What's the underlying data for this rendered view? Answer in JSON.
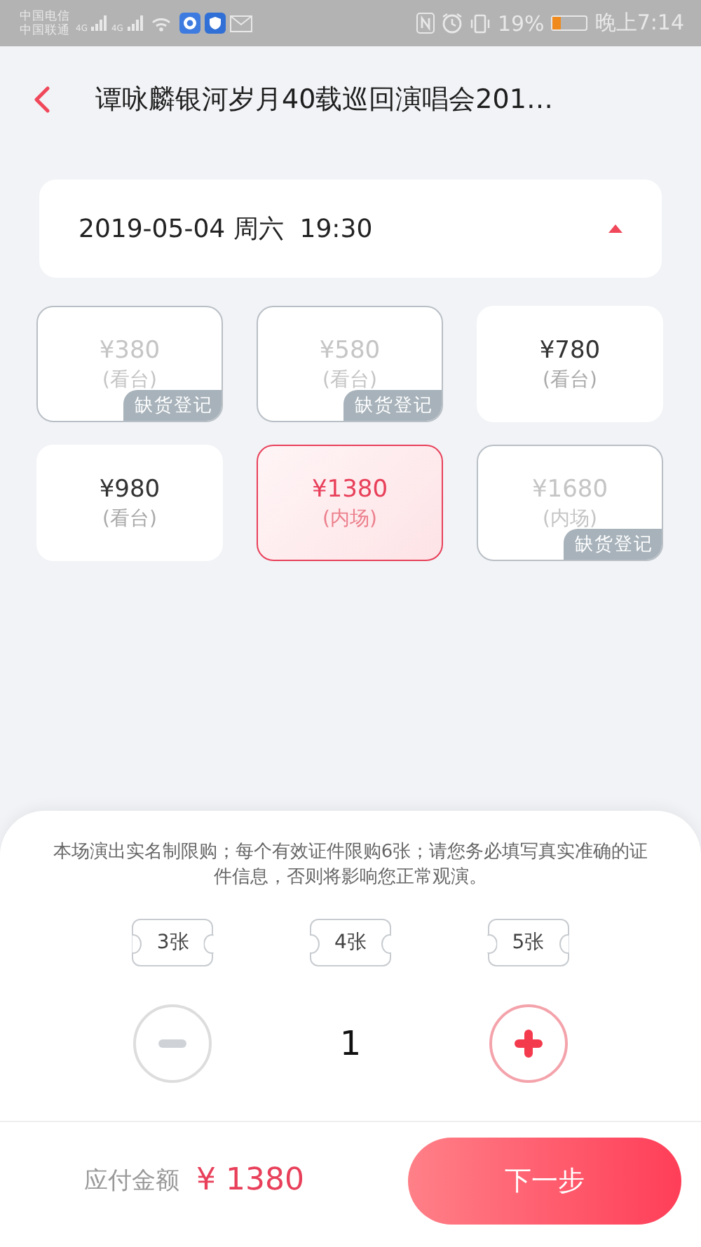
{
  "status_bar": {
    "carriers": [
      "中国电信",
      "中国联通"
    ],
    "networks": [
      "4G",
      "4G"
    ],
    "battery": "19%",
    "time": "晚上7:14"
  },
  "header": {
    "title": "谭咏麟银河岁月40载巡回演唱会201…"
  },
  "session": {
    "date": "2019-05-04 周六  19:30",
    "expanded": true
  },
  "tickets": [
    {
      "price": "¥380",
      "area": "(看台)",
      "available": false,
      "selected": false,
      "tag": "缺货登记"
    },
    {
      "price": "¥580",
      "area": "(看台)",
      "available": false,
      "selected": false,
      "tag": "缺货登记"
    },
    {
      "price": "¥780",
      "area": "(看台)",
      "available": true,
      "selected": false
    },
    {
      "price": "¥980",
      "area": "(看台)",
      "available": true,
      "selected": false
    },
    {
      "price": "¥1380",
      "area": "(内场)",
      "available": true,
      "selected": true
    },
    {
      "price": "¥1680",
      "area": "(内场)",
      "available": false,
      "selected": false,
      "tag": "缺货登记"
    }
  ],
  "notice": "本场演出实名制限购；每个有效证件限购6张；请您务必填写真实准确的证件信息，否则将影响您正常观演。",
  "quick_counts": [
    "3张",
    "4张",
    "5张"
  ],
  "stepper": {
    "quantity": "1",
    "minus_disabled": true,
    "plus_disabled": false
  },
  "footer": {
    "label": "应付金额",
    "amount": "¥ 1380",
    "button": "下一步"
  }
}
